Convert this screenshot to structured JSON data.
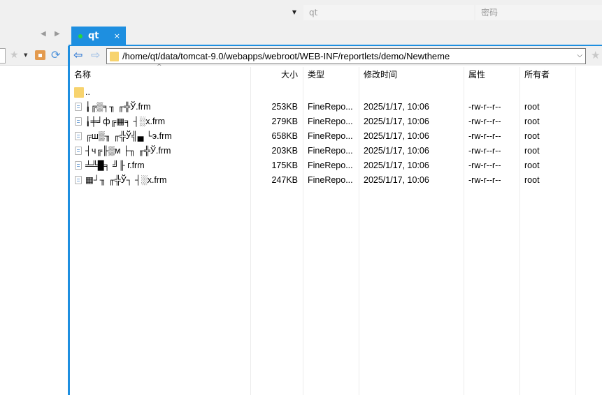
{
  "login": {
    "host_value": "",
    "user_value": "qt",
    "password_placeholder": "密码"
  },
  "tabs": [
    {
      "label": "qt",
      "close": "×"
    }
  ],
  "tab_nav": {
    "prev": "◀",
    "next": "▶"
  },
  "left_toolbar": {
    "star": "★",
    "dropdown": "▼",
    "refresh": "⟳"
  },
  "right_toolbar": {
    "back": "⇦",
    "forward": "⇨",
    "path": "/home/qt/data/tomcat-9.0/webapps/webroot/WEB-INF/reportlets/demo/Newtheme",
    "path_dropdown": "⌵",
    "bookmark": "★"
  },
  "columns": {
    "name": "名称",
    "size": "大小",
    "type": "类型",
    "modified": "修改时间",
    "permissions": "属性",
    "owner": "所有者",
    "sort_indicator": "^"
  },
  "parent_dir": "..",
  "files": [
    {
      "name": "╽╔▒╕╖ ╓╬Ў.frm",
      "size": "253KB",
      "type": "FineRepo...",
      "modified": "2025/1/17, 10:06",
      "permissions": "-rw-r--r--",
      "owner": "root"
    },
    {
      "name": "╽╪╛ф╔▦╕ ┤░x.frm",
      "size": "279KB",
      "type": "FineRepo...",
      "modified": "2025/1/17, 10:06",
      "permissions": "-rw-r--r--",
      "owner": "root"
    },
    {
      "name": "╔ш▒╖ ╓╬Ў╣▄ └э.frm",
      "size": "658KB",
      "type": "FineRepo...",
      "modified": "2025/1/17, 10:06",
      "permissions": "-rw-r--r--",
      "owner": "root"
    },
    {
      "name": "┤ч╔╟▒м ├╖ ╓╬Ў.frm",
      "size": "203KB",
      "type": "FineRepo...",
      "modified": "2025/1/17, 10:06",
      "permissions": "-rw-r--r--",
      "owner": "root"
    },
    {
      "name": "╧╩█╕ ╝╟ г.frm",
      "size": "175KB",
      "type": "FineRepo...",
      "modified": "2025/1/17, 10:06",
      "permissions": "-rw-r--r--",
      "owner": "root"
    },
    {
      "name": "▦┘╖ ╓╬Ў┐ ┤░x.frm",
      "size": "247KB",
      "type": "FineRepo...",
      "modified": "2025/1/17, 10:06",
      "permissions": "-rw-r--r--",
      "owner": "root"
    }
  ]
}
